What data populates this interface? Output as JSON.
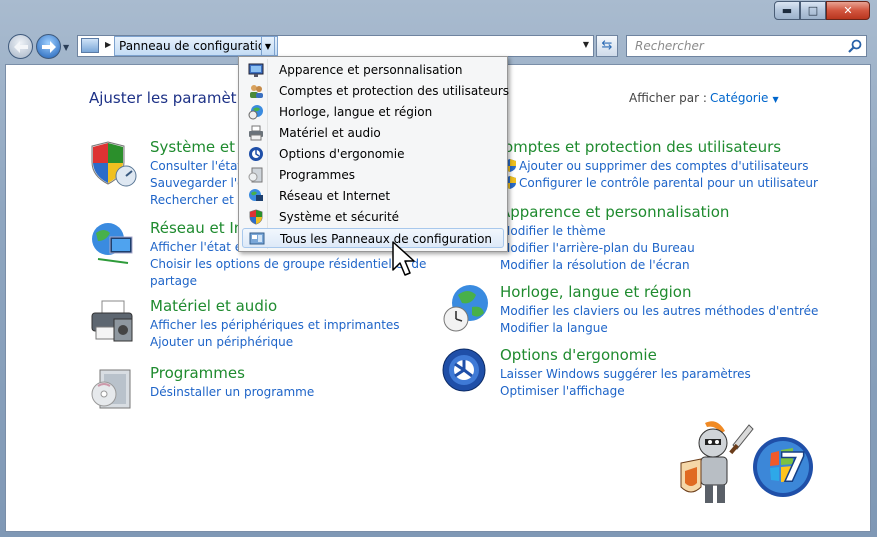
{
  "window": {
    "buttons": {
      "minimize": "▬",
      "maximize": "□",
      "close": "✕"
    }
  },
  "nav": {
    "back_icon": "back-arrow-icon",
    "forward_icon": "forward-arrow-icon",
    "address": {
      "crumb": "Panneau de configuration"
    },
    "search": {
      "placeholder": "Rechercher"
    }
  },
  "content": {
    "heading": "Ajuster les paramètres",
    "view_by_label": "Afficher par :",
    "view_by_value": "Catégorie",
    "categories_left": [
      {
        "title": "Système et sé",
        "icon": "shield-icon",
        "links": [
          "Consulter l'état d",
          "Sauvegarder l'ord",
          "Rechercher et rés"
        ]
      },
      {
        "title": "Réseau et Int",
        "icon": "network-globe-icon",
        "links": [
          "Afficher l'état et l",
          "Choisir les options de groupe résidentiel et de",
          "partage"
        ]
      },
      {
        "title": "Matériel et audio",
        "icon": "printer-icon",
        "links": [
          "Afficher les périphériques et imprimantes",
          "Ajouter un périphérique"
        ]
      },
      {
        "title": "Programmes",
        "icon": "programs-box-icon",
        "links": [
          "Désinstaller un programme"
        ]
      }
    ],
    "categories_right": [
      {
        "title": "omptes et protection des utilisateurs",
        "icon": "users-icon",
        "links": [
          "Ajouter ou supprimer des comptes d'utilisateurs",
          "Configurer le contrôle parental pour un utilisateur"
        ]
      },
      {
        "title": "Apparence et personnalisation",
        "icon": "appearance-icon",
        "links": [
          "Modifier le thème",
          "Modifier l'arrière-plan du Bureau",
          "Modifier la résolution de l'écran"
        ]
      },
      {
        "title": "Horloge, langue et région",
        "icon": "clock-globe-icon",
        "links": [
          "Modifier les claviers ou les autres méthodes d'entrée",
          "Modifier la langue"
        ]
      },
      {
        "title": "Options d'ergonomie",
        "icon": "ease-of-access-icon",
        "links": [
          "Laisser Windows suggérer les paramètres",
          "Optimiser l'affichage"
        ]
      }
    ]
  },
  "menu": {
    "items": [
      {
        "label": "Apparence et personnalisation",
        "icon": "appearance-icon"
      },
      {
        "label": "Comptes et protection des utilisateurs",
        "icon": "users-icon"
      },
      {
        "label": "Horloge, langue et région",
        "icon": "clock-globe-icon"
      },
      {
        "label": "Matériel et audio",
        "icon": "printer-icon"
      },
      {
        "label": "Options d'ergonomie",
        "icon": "ease-of-access-icon"
      },
      {
        "label": "Programmes",
        "icon": "programs-box-icon"
      },
      {
        "label": "Réseau et Internet",
        "icon": "network-globe-icon"
      },
      {
        "label": "Système et sécurité",
        "icon": "shield-icon"
      },
      {
        "label": "Tous les Panneaux de configuration",
        "icon": "control-panel-icon",
        "active": true
      }
    ]
  },
  "colors": {
    "link": "#1e64c8",
    "category_title": "#1f8b2f",
    "heading": "#1e3287"
  }
}
